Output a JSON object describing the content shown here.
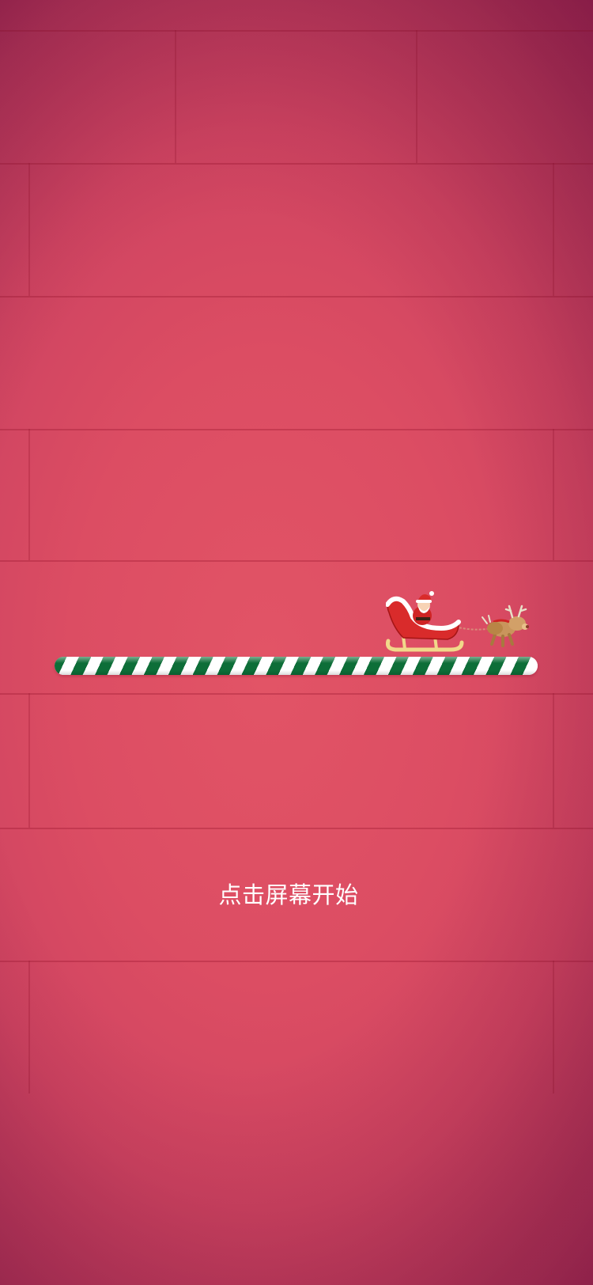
{
  "game": {
    "start_hint": "点击屏幕开始"
  },
  "loading": {
    "progress_percent": 100
  },
  "sprites": {
    "santa_sleigh": "santa-sleigh-icon",
    "reindeer": "reindeer-icon"
  },
  "colors": {
    "background": "#dc4d63",
    "background_edge": "#8f1f4e",
    "stripe_green": "#0d6e38",
    "stripe_white": "#ffffff",
    "text": "#ffffff"
  }
}
